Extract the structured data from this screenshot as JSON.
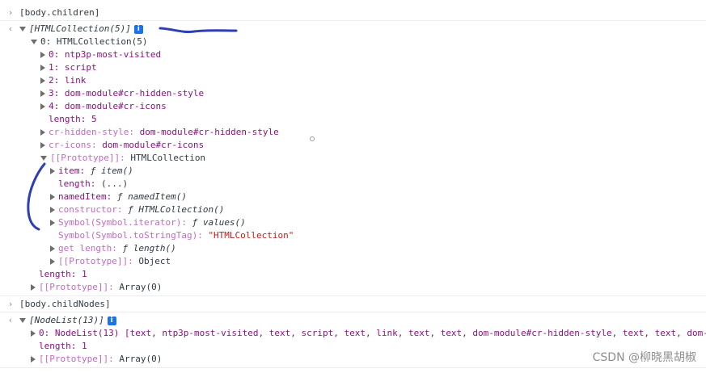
{
  "console": {
    "cmd1": "[body.children]",
    "result1": {
      "summary": "[HTMLCollection(5)]",
      "item0_label": "0: HTMLCollection(5)",
      "children": [
        {
          "key": "0",
          "value": "ntp3p-most-visited"
        },
        {
          "key": "1",
          "value": "script"
        },
        {
          "key": "2",
          "value": "link"
        },
        {
          "key": "3",
          "value": "dom-module#cr-hidden-style"
        },
        {
          "key": "4",
          "value": "dom-module#cr-icons"
        }
      ],
      "length_line": "length: 5",
      "named1": {
        "key": "cr-hidden-style",
        "value": "dom-module#cr-hidden-style"
      },
      "named2": {
        "key": "cr-icons",
        "value": "dom-module#cr-icons"
      },
      "proto_key": "[[Prototype]]",
      "proto_value": "HTMLCollection",
      "proto_members": {
        "item": {
          "key": "item",
          "value": "ƒ item()"
        },
        "length": {
          "key": "length",
          "value": "(...)"
        },
        "namedItem": {
          "key": "namedItem",
          "value": "ƒ namedItem()"
        },
        "constructor": {
          "key": "constructor",
          "value": "ƒ HTMLCollection()"
        },
        "iterator": {
          "key": "Symbol(Symbol.iterator)",
          "value": "ƒ values()"
        },
        "tostringtag": {
          "key": "Symbol(Symbol.toStringTag)",
          "value": "\"HTMLCollection\""
        },
        "getlength": {
          "key": "get length",
          "value": "ƒ length()"
        },
        "proto": {
          "key": "[[Prototype]]",
          "value": "Object"
        }
      },
      "outer_length": "length: 1",
      "outer_proto_key": "[[Prototype]]",
      "outer_proto_value": "Array(0)"
    },
    "cmd2": "[body.childNodes]",
    "result2": {
      "summary": "[NodeList(13)]",
      "item0": "0: NodeList(13) [text, ntp3p-most-visited, text, script, text, link, text, text, dom-module#cr-hidden-style, text, text, dom-",
      "length_line": "length: 1",
      "proto_key": "[[Prototype]]",
      "proto_value": "Array(0)"
    },
    "info_icon": "i"
  },
  "watermark": "CSDN @柳晓黑胡椒",
  "colors": {
    "annotation": "#2f3fb3",
    "key": "#881280",
    "string": "#c41a16"
  }
}
